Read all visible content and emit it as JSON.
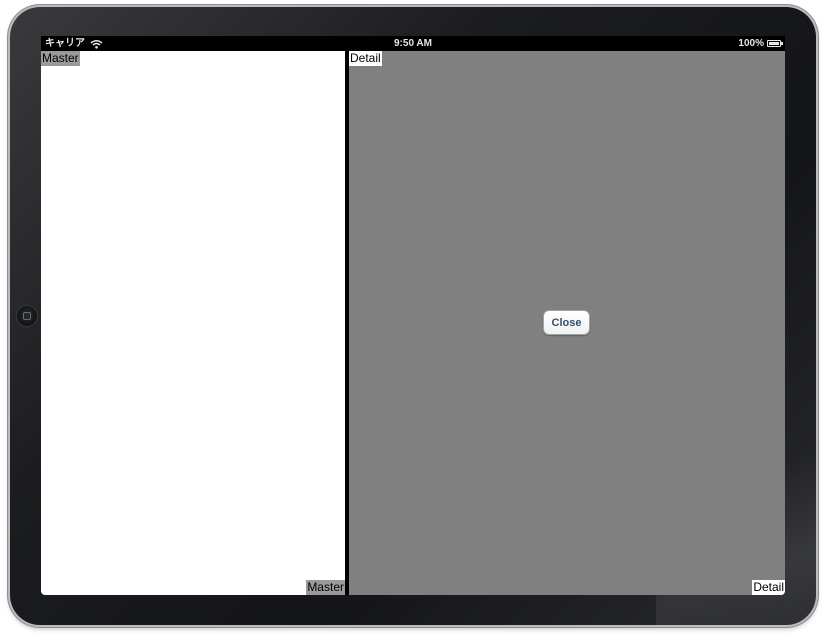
{
  "status_bar": {
    "carrier": "キャリア",
    "time": "9:50 AM",
    "battery_percent": "100%",
    "battery_level": 1.0,
    "icons": [
      "wifi-icon",
      "battery-icon"
    ]
  },
  "master": {
    "top_label": "Master",
    "bottom_label": "Master",
    "background": "#ffffff"
  },
  "detail": {
    "top_label": "Detail",
    "bottom_label": "Detail",
    "background": "#808080",
    "close_button_label": "Close"
  },
  "colors": {
    "button_text": "#364d6f",
    "label_highlight": "#9a9a9a"
  }
}
